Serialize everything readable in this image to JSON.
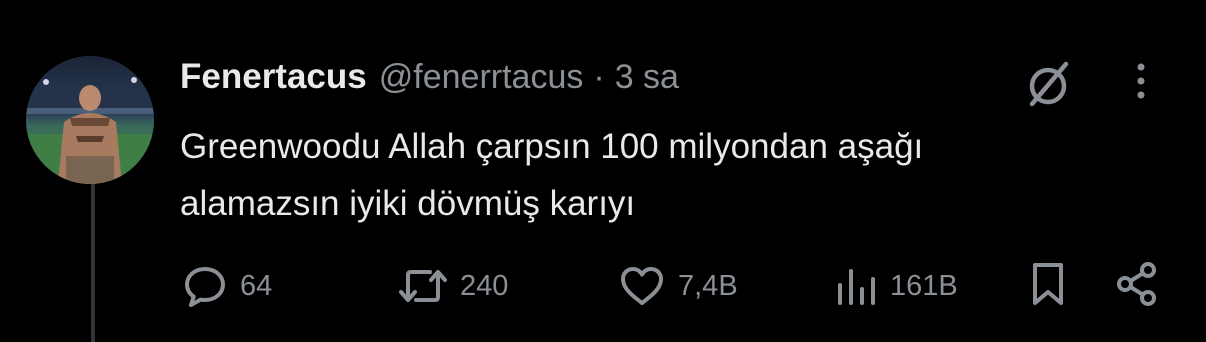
{
  "tweet": {
    "author_name": "Fenertacus",
    "handle": "@fenerrtacus",
    "separator": "·",
    "time": "3 sa",
    "text": "Greenwoodu Allah çarpsın 100 milyondan aşağı\nalamazsın iyiki dövmüş karıyı"
  },
  "actions": {
    "replies": "64",
    "reposts": "240",
    "likes": "7,4B",
    "views": "161B"
  },
  "icons": {
    "grok": "grok-icon",
    "more": "more-dots-icon",
    "reply": "reply-bubble-icon",
    "repost": "repost-icon",
    "like": "heart-icon",
    "views": "bar-chart-icon",
    "bookmark": "bookmark-icon",
    "share": "share-icon"
  },
  "colors": {
    "background": "#000000",
    "text": "#e7e9ea",
    "secondary": "#8b9096",
    "thread_line": "#333639"
  }
}
